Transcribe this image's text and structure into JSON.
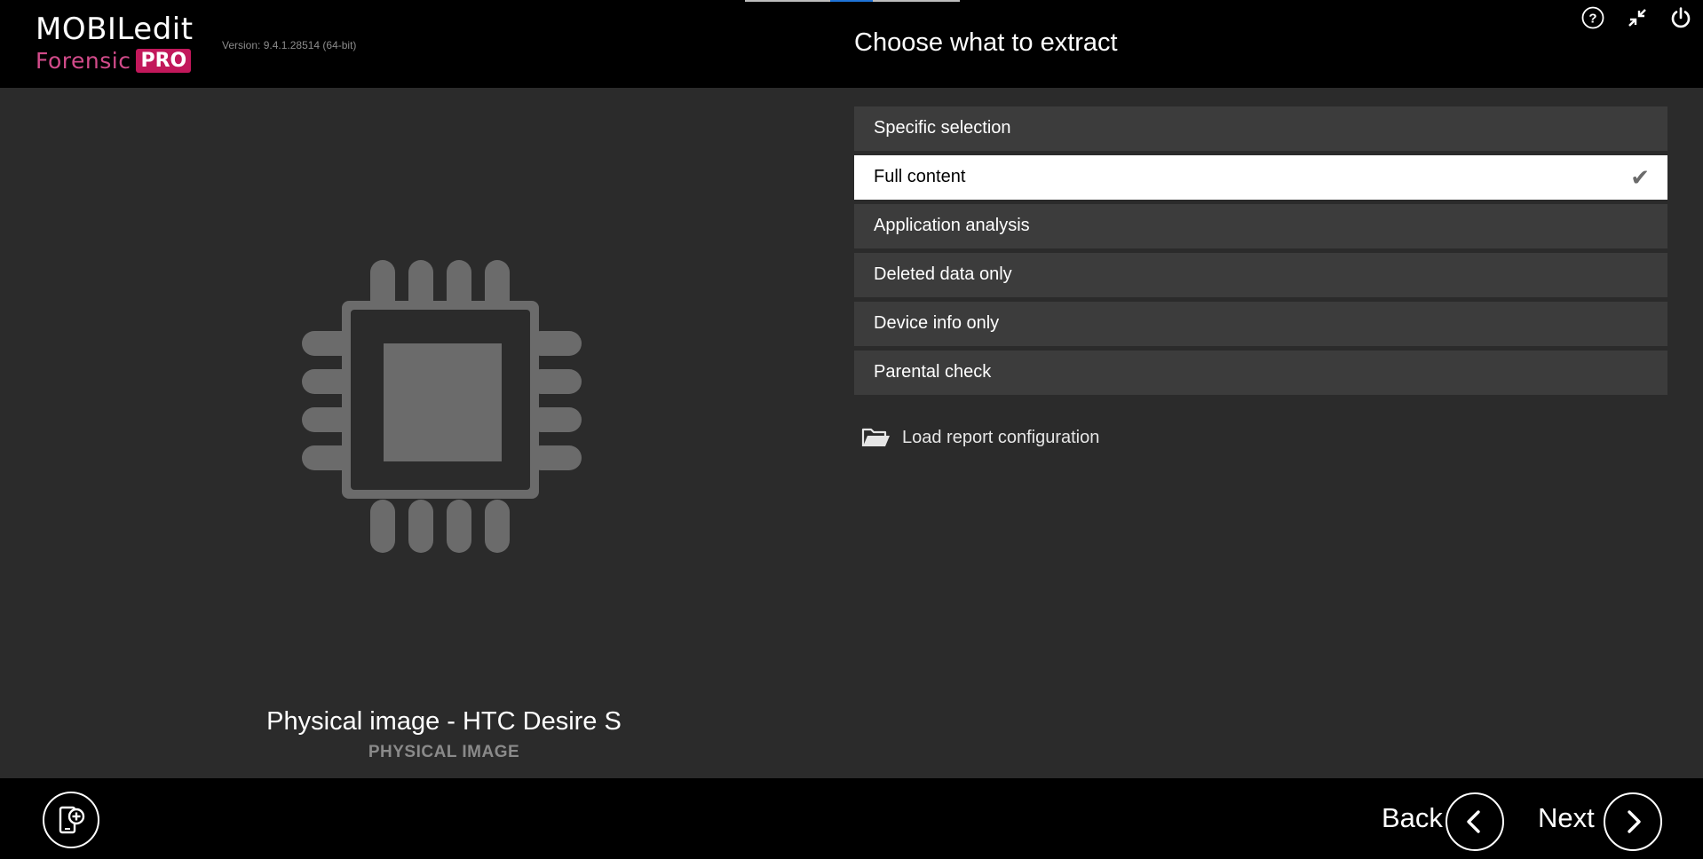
{
  "app": {
    "logo_main": "MOBILedit",
    "logo_forensic": "Forensic",
    "logo_pro": "PRO",
    "version": "Version: 9.4.1.28514 (64-bit)"
  },
  "header": {
    "title": "Choose what to extract",
    "icons": [
      "help-icon",
      "minimize-icon",
      "power-icon"
    ]
  },
  "device": {
    "icon": "chip-icon",
    "name": "Physical image - HTC Desire S",
    "type": "PHYSICAL IMAGE"
  },
  "options": [
    {
      "label": "Specific selection",
      "selected": false
    },
    {
      "label": "Full content",
      "selected": true
    },
    {
      "label": "Application analysis",
      "selected": false
    },
    {
      "label": "Deleted data only",
      "selected": false
    },
    {
      "label": "Device info only",
      "selected": false
    },
    {
      "label": "Parental check",
      "selected": false
    }
  ],
  "load_config": {
    "label": "Load report configuration",
    "icon": "folder-open-icon"
  },
  "footer": {
    "add_device_icon": "add-device-icon",
    "back_label": "Back",
    "next_label": "Next"
  },
  "colors": {
    "background": "#2b2b2b",
    "bar": "#000000",
    "option_bg": "#3c3c3c",
    "selected_bg": "#ffffff",
    "brand_pink": "#c2185b",
    "chip_gray": "#6b6b6b"
  }
}
